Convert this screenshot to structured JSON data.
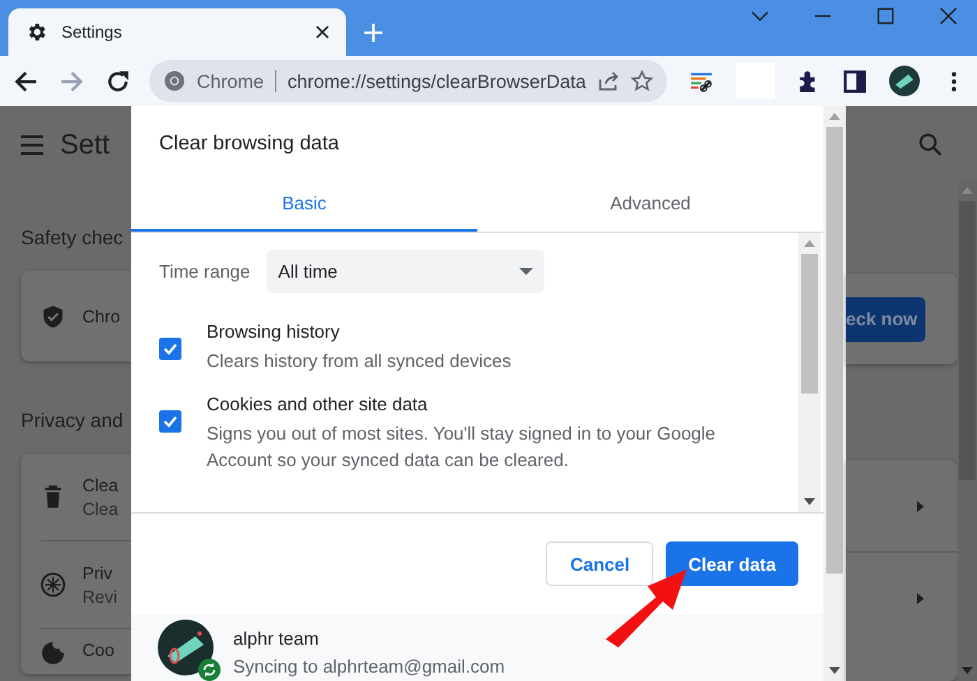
{
  "browser": {
    "tab": {
      "title": "Settings"
    },
    "omnibox": {
      "site": "Chrome",
      "url": "chrome://settings/clearBrowserData"
    }
  },
  "background_page": {
    "title": "Sett",
    "safety": {
      "heading": "Safety chec",
      "card_text": "Chro",
      "button": "eck now"
    },
    "privacy": {
      "heading": "Privacy and",
      "rows": [
        {
          "kind": "trash",
          "title": "Clea",
          "subtitle": "Clea"
        },
        {
          "kind": "compass",
          "title": "Priv",
          "subtitle": "Revi"
        },
        {
          "kind": "cookie",
          "title": "Coo"
        }
      ]
    }
  },
  "dialog": {
    "title": "Clear browsing data",
    "tabs": [
      {
        "label": "Basic",
        "selected": true
      },
      {
        "label": "Advanced",
        "selected": false
      }
    ],
    "time_range": {
      "label": "Time range",
      "value": "All time"
    },
    "options": [
      {
        "title": "Browsing history",
        "description": "Clears history from all synced devices",
        "checked": true
      },
      {
        "title": "Cookies and other site data",
        "description": "Signs you out of most sites. You'll stay signed in to your Google Account so your synced data can be cleared.",
        "checked": true
      }
    ],
    "buttons": [
      {
        "label": "Cancel",
        "kind": "secondary"
      },
      {
        "label": "Clear data",
        "kind": "primary"
      }
    ],
    "account": {
      "name": "alphr team",
      "status": "Syncing to alphrteam@gmail.com"
    }
  }
}
